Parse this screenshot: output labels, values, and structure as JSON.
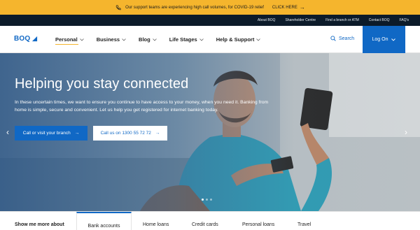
{
  "alert": {
    "message": "Our support teams are experiencing high call volumes, for COVID-19 relief",
    "cta_label": "CLICK HERE",
    "icon": "phone-icon",
    "bg_color": "#f5b52d"
  },
  "utility_links": [
    "About BOQ",
    "Shareholder Centre",
    "Find a branch or ATM",
    "Contact BOQ",
    "FAQ's"
  ],
  "header": {
    "logo_text": "BOQ",
    "menu": [
      {
        "label": "Personal"
      },
      {
        "label": "Business"
      },
      {
        "label": "Blog"
      },
      {
        "label": "Life Stages"
      },
      {
        "label": "Help & Support"
      }
    ],
    "search_label": "Search",
    "logon_label": "Log On",
    "brand_color": "#1068c5"
  },
  "hero": {
    "title": "Helping you stay connected",
    "body": "In these uncertain times, we want to ensure you continue to have access to your money, when you need it. Banking from home is simple, secure and convenient. Let us help you get registered for internet banking today.",
    "primary_button": "Call or visit your branch",
    "secondary_button": "Call us on 1300 55 72 72",
    "slide_count": 3,
    "active_slide": 1
  },
  "bottom_tabs": {
    "label": "Show me more about",
    "tabs": [
      "Bank accounts",
      "Home loans",
      "Credit cards",
      "Personal loans",
      "Travel"
    ],
    "active_tab": "Bank accounts"
  }
}
